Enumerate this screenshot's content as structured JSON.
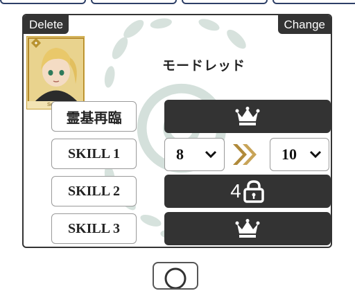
{
  "card": {
    "delete_label": "Delete",
    "change_label": "Change",
    "portrait_label": "Servant",
    "servant_name": "モードレッド"
  },
  "rows": {
    "ascension_label": "霊基再臨",
    "skill1_label": "SKILL 1",
    "skill2_label": "SKILL 2",
    "skill3_label": "SKILL 3"
  },
  "skill1": {
    "from_value": "8",
    "to_value": "10"
  },
  "skill2": {
    "lock_count": "4"
  },
  "icons": {
    "ascension": "crown-icon",
    "skill3": "crown-icon",
    "skill2": "lock-icon",
    "arrow": "double-chevron-right-icon",
    "bottom": "circle-icon"
  },
  "colors": {
    "dark": "#333333",
    "arrow_gold": "#b08a3a",
    "watermark": "#c6d6cf"
  }
}
